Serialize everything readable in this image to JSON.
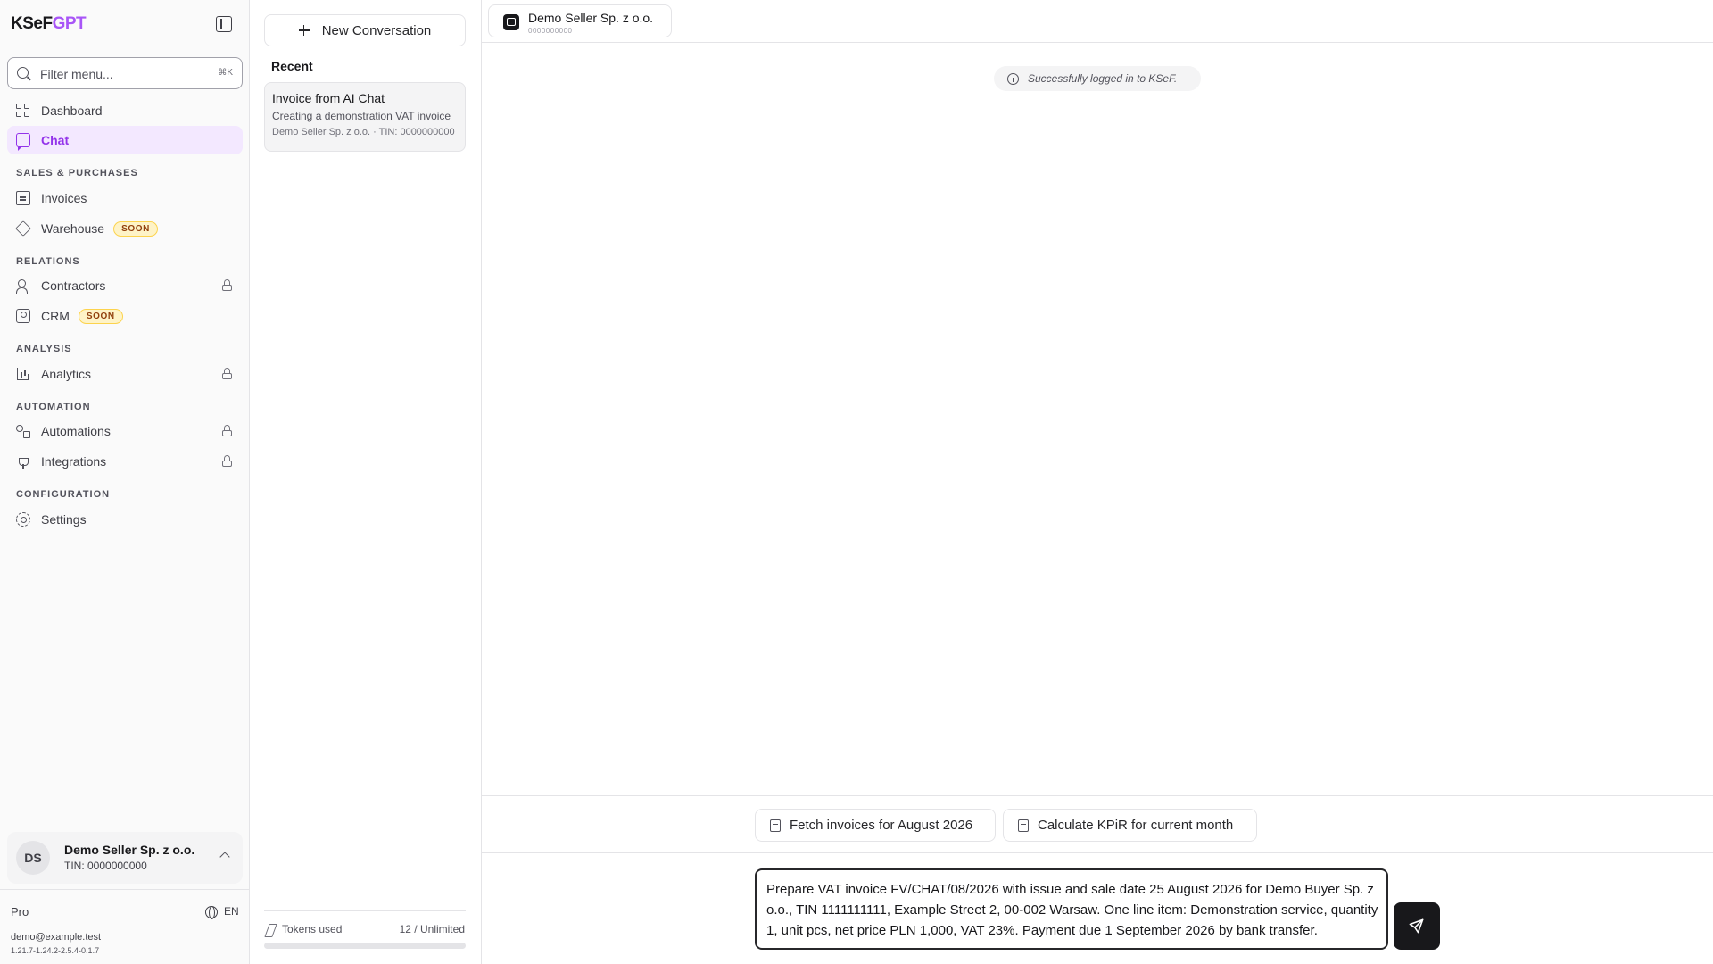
{
  "app": {
    "logo_part1": "KSeF",
    "logo_part2": "GPT"
  },
  "sidebar": {
    "filter_placeholder": "Filter menu...",
    "filter_shortcut": "⌘K",
    "items": [
      {
        "label": "Dashboard",
        "icon": "dashboard-icon"
      },
      {
        "label": "Chat",
        "icon": "chat-icon",
        "active": true
      },
      {
        "label": "Invoices",
        "icon": "invoice-icon"
      },
      {
        "label": "Warehouse",
        "icon": "package-icon",
        "badge": "SOON"
      },
      {
        "label": "Contractors",
        "icon": "users-icon",
        "locked": true
      },
      {
        "label": "CRM",
        "icon": "contact-icon",
        "badge": "SOON"
      },
      {
        "label": "Analytics",
        "icon": "bar-chart-icon",
        "locked": true
      },
      {
        "label": "Automations",
        "icon": "workflow-icon",
        "locked": true
      },
      {
        "label": "Integrations",
        "icon": "plug-icon",
        "locked": true
      },
      {
        "label": "Settings",
        "icon": "gear-icon"
      }
    ],
    "sections": {
      "sales": "SALES & PURCHASES",
      "relations": "RELATIONS",
      "analysis": "ANALYSIS",
      "automation": "AUTOMATION",
      "configuration": "CONFIGURATION"
    },
    "account": {
      "initials": "DS",
      "name": "Demo Seller Sp. z o.o.",
      "tin": "TIN: 0000000000"
    },
    "plan": "Pro",
    "language": "EN",
    "email": "demo@example.test",
    "version": "1.21.7-1.24.2-2.5.4-0.1.7"
  },
  "conversations": {
    "new_label": "New Conversation",
    "recent_title": "Recent",
    "items": [
      {
        "title": "Invoice from AI Chat",
        "preview": "Creating a demonstration VAT invoice",
        "meta": "Demo Seller Sp. z o.o. · TIN: 0000000000"
      }
    ],
    "tokens_label": "Tokens used",
    "tokens_value": "12 / Unlimited",
    "tokens_fraction": 0.0
  },
  "main": {
    "company": {
      "name": "Demo Seller Sp. z o.o.",
      "tin": "0000000000"
    },
    "toast": "Successfully logged in to KSeF.",
    "suggestions": [
      "Fetch invoices for August 2026",
      "Calculate KPiR for current month"
    ],
    "composer_value": "Prepare VAT invoice FV/CHAT/08/2026 with issue and sale date 25 August 2026 for Demo Buyer Sp. z o.o., TIN 1111111111, Example Street 2, 00-002 Warsaw. One line item: Demonstration service, quantity 1, unit pcs, net price PLN 1,000, VAT 23%. Payment due 1 September 2026 by bank transfer."
  },
  "colors": {
    "accent": "#9333ea",
    "active_bg": "#f3e8ff",
    "badge_bg": "#fef3c7",
    "send_bg": "#18181b"
  }
}
